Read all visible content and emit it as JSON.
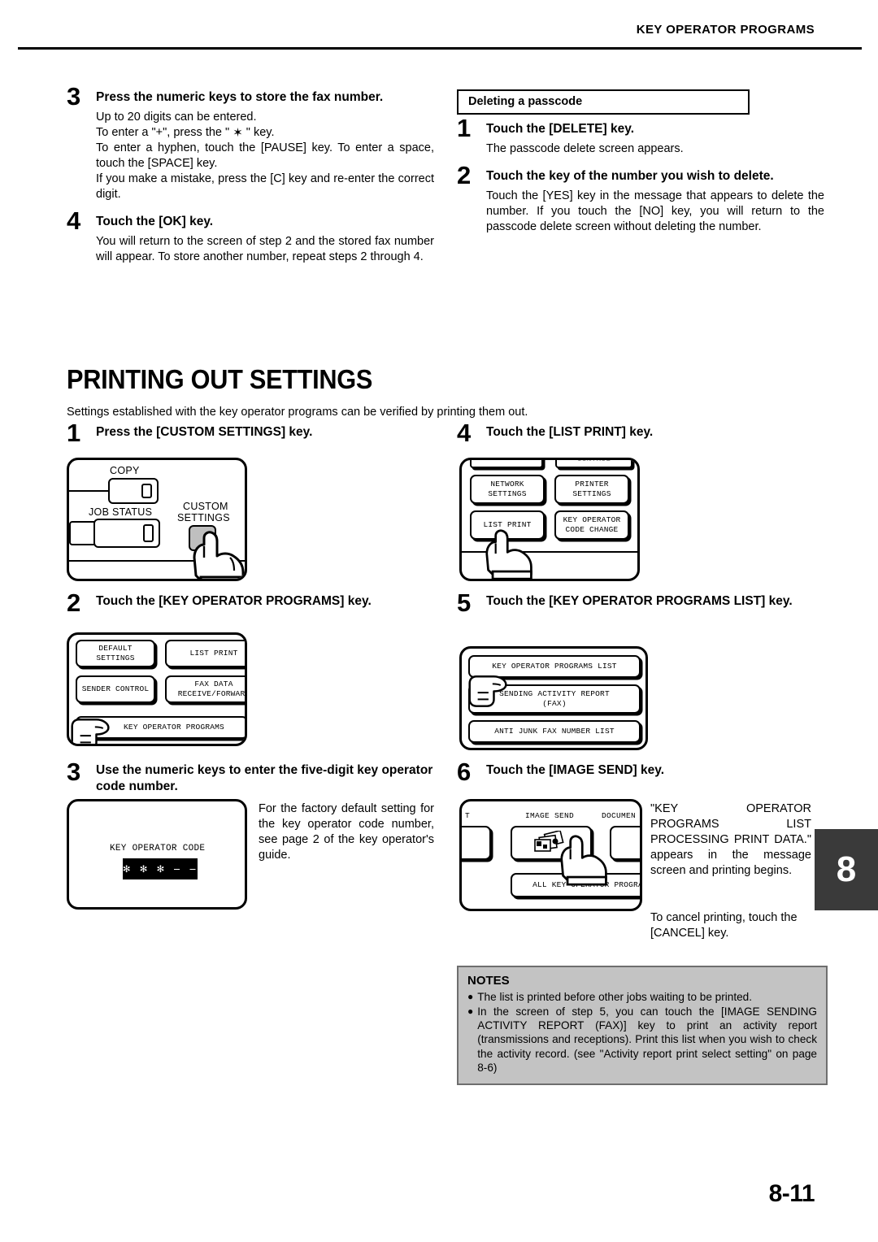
{
  "header": {
    "running_head": "KEY OPERATOR PROGRAMS"
  },
  "page": {
    "number": "8-11",
    "chapter_tab": "8"
  },
  "left_column": {
    "step3": {
      "num": "3",
      "title": "Press the numeric keys to store the fax number.",
      "line1": "Up to 20 digits can be entered.",
      "line2_pre": "To enter a \"+\", press the \" ",
      "line2_glyph": "✶",
      "line2_post": " \" key.",
      "line3": "To enter a hyphen, touch the [PAUSE] key. To enter a space, touch the [SPACE] key.",
      "line4": "If you make a mistake, press the [C] key and re-enter the correct digit."
    },
    "step4": {
      "num": "4",
      "title": "Touch the [OK] key.",
      "body": "You will return to the screen of step 2 and the stored fax number will appear. To store another number, repeat steps 2 through 4."
    }
  },
  "right_column": {
    "subhead": "Deleting a passcode",
    "step1": {
      "num": "1",
      "title": "Touch the [DELETE] key.",
      "body": "The passcode delete screen appears."
    },
    "step2": {
      "num": "2",
      "title": "Touch the key of the number you wish to delete.",
      "body": "Touch the [YES] key in the message that appears to delete the number. If you touch the [NO] key, you will return to the passcode delete screen without deleting the number."
    }
  },
  "section": {
    "title": "PRINTING OUT SETTINGS",
    "intro": "Settings established with the key operator programs can be verified by printing them out."
  },
  "printing_steps": {
    "step1": {
      "num": "1",
      "title": "Press the [CUSTOM SETTINGS] key."
    },
    "step2": {
      "num": "2",
      "title": "Touch the [KEY OPERATOR PROGRAMS] key."
    },
    "step3": {
      "num": "3",
      "title": "Use the numeric keys to enter the five-digit key operator code number.",
      "body": "For the factory default setting for the key operator code number, see page 2 of the key operator's guide."
    },
    "step4": {
      "num": "4",
      "title": "Touch the [LIST PRINT] key."
    },
    "step5": {
      "num": "5",
      "title": "Touch the [KEY OPERATOR PROGRAMS LIST] key."
    },
    "step6": {
      "num": "6",
      "title": "Touch the [IMAGE SEND] key.",
      "body": "\"KEY OPERATOR PROGRAMS LIST PROCESSING PRINT DATA.\" appears in the message screen and printing begins.",
      "body2": "To cancel printing, touch the [CANCEL] key."
    }
  },
  "panels": {
    "custom_settings": {
      "copy_label": "COPY",
      "job_status_label": "JOB STATUS",
      "custom_settings_label_line1": "CUSTOM",
      "custom_settings_label_line2": "SETTINGS"
    },
    "key_operator_programs": {
      "keys": [
        "DEFAULT\nSETTINGS",
        "LIST PRINT",
        "SENDER CONTROL",
        "FAX DATA\nRECEIVE/FORWARD",
        "KEY OPERATOR PROGRAMS"
      ],
      "key_default_settings": "DEFAULT SETTINGS",
      "key_list_print": "LIST PRINT",
      "key_sender_control": "SENDER CONTROL",
      "key_fax_data": "FAX DATA RECEIVE/FORWARD",
      "key_key_operator_programs": "KEY OPERATOR PROGRAMS"
    },
    "key_operator_code": {
      "label": "KEY OPERATOR CODE",
      "value": "✻ ✻ ✻ ⎯ ⎯"
    },
    "list_print_panel": {
      "partial_top_right": "CONTROL",
      "key_network_settings_l1": "NETWORK",
      "key_network_settings_l2": "SETTINGS",
      "key_printer_settings_l1": "PRINTER",
      "key_printer_settings_l2": "SETTINGS",
      "key_list_print": "LIST PRINT",
      "key_key_operator_l1": "KEY OPERATOR",
      "key_key_operator_l2": "CODE CHANGE"
    },
    "programs_list_panel": {
      "key1": "KEY OPERATOR PROGRAMS LIST",
      "key2_l1": "SENDING ACTIVITY REPORT",
      "key2_l2": "(FAX)",
      "key3": "ANTI JUNK FAX NUMBER LIST"
    },
    "image_send_panel": {
      "label_left_partial": "T",
      "label_image_send": "IMAGE SEND",
      "label_document_partial": "DOCUMEN",
      "key_all": "ALL KEY OPERATOR PROGRA"
    }
  },
  "notes": {
    "title": "NOTES",
    "items": [
      "The list is printed before other jobs waiting to be printed.",
      "In the screen of step 5, you can touch the [IMAGE SENDING ACTIVITY REPORT (FAX)] key to print an activity report (transmissions and receptions). Print this list when you wish to check the activity record. (see \"Activity report print select setting\" on page 8-6)"
    ]
  }
}
